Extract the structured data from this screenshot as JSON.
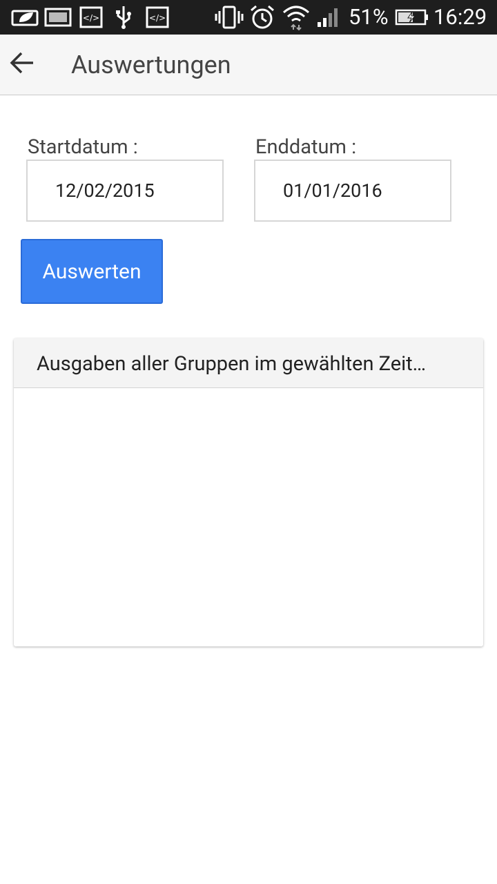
{
  "status_bar": {
    "icons": [
      "leaf-notification-icon",
      "image-notification-icon",
      "code-notification-icon",
      "usb-icon",
      "code-notification-icon",
      "vibrate-icon",
      "alarm-icon",
      "wifi-icon",
      "signal-icon",
      "battery-charging-icon"
    ],
    "battery": "51%",
    "time": "16:29"
  },
  "app_bar": {
    "title": "Auswertungen",
    "back_icon": "arrow-left-icon"
  },
  "form": {
    "start_label": "Startdatum :",
    "start_value": "12/02/2015",
    "end_label": "Enddatum :",
    "end_value": "01/01/2016",
    "button_label": "Auswerten"
  },
  "card": {
    "title": "Ausgaben aller Gruppen im gewählten Zeit…"
  },
  "colors": {
    "accent": "#3b82f2",
    "status_bar": "#1e1e1e",
    "app_bar": "#f6f6f6"
  }
}
